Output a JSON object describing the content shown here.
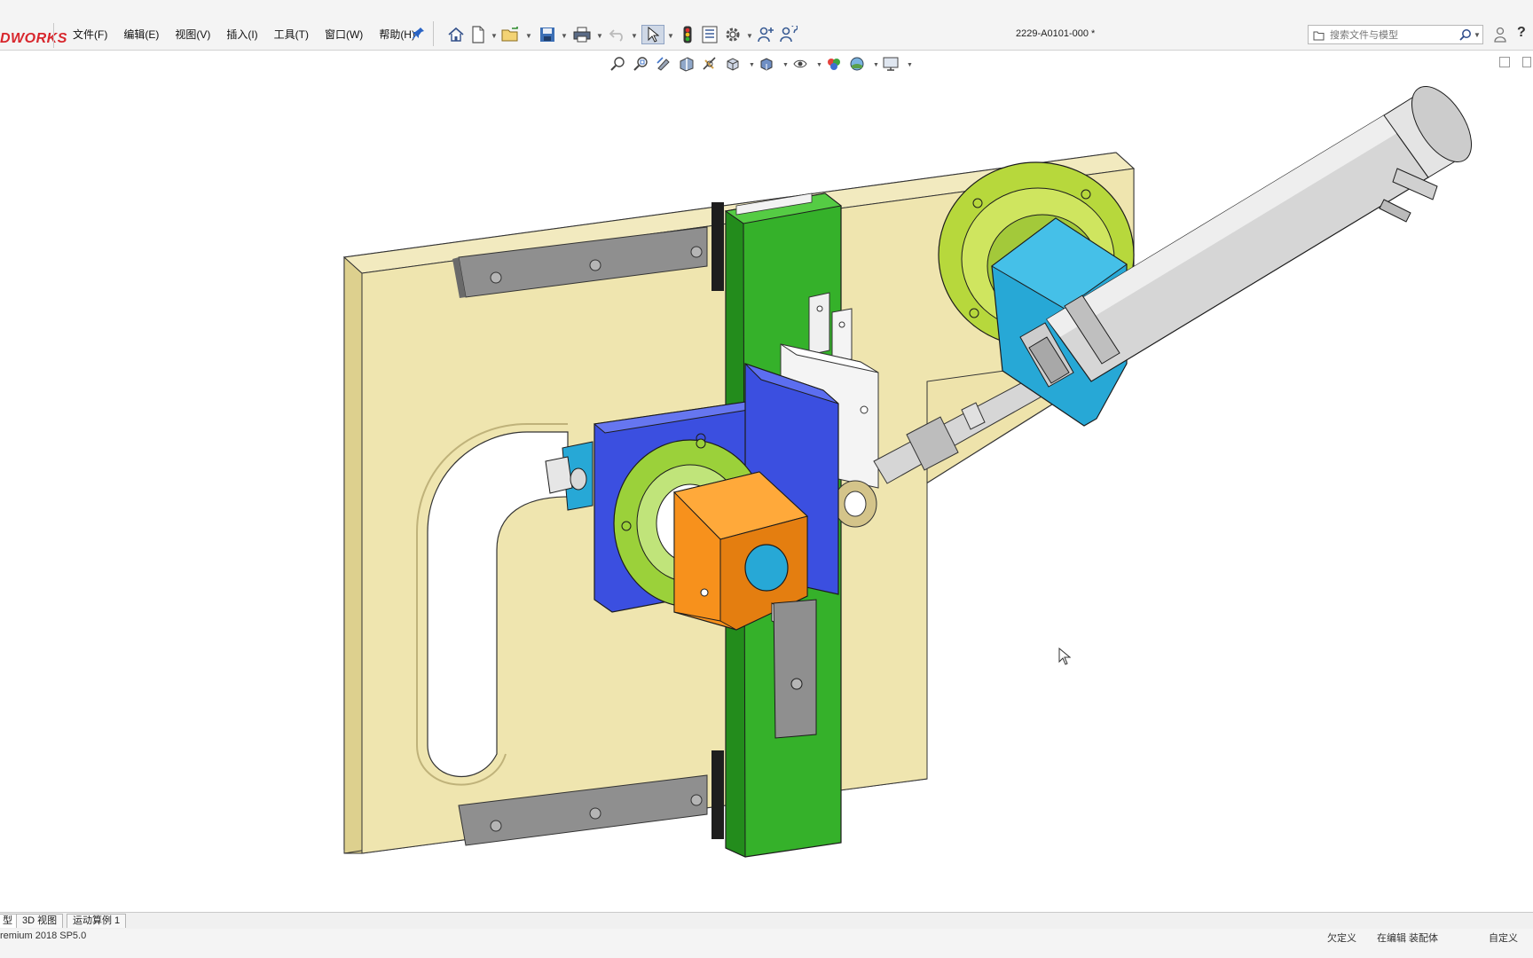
{
  "app": {
    "logo_text": "DWORKS",
    "document_title": "2229-A0101-000 *"
  },
  "menu": {
    "items": [
      "文件(F)",
      "编辑(E)",
      "视图(V)",
      "插入(I)",
      "工具(T)",
      "窗口(W)",
      "帮助(H)"
    ]
  },
  "search": {
    "placeholder": "搜索文件与模型"
  },
  "bottom_tabs": {
    "items": [
      "型",
      "3D 视图",
      "运动算例 1"
    ],
    "active_index": 0
  },
  "status": {
    "left_text": "remium 2018 SP5.0",
    "right_1": "欠定义",
    "right_2": "在编辑 装配体",
    "right_3": "自定义"
  },
  "icons": {
    "toolbar": [
      "home-icon",
      "new-document-icon",
      "open-folder-icon",
      "save-icon",
      "print-icon",
      "undo-icon",
      "select-arrow-icon",
      "traffic-light-icon",
      "file-properties-icon",
      "options-gear-icon",
      "user-assist-icon",
      "user-help-icon"
    ],
    "heads_up": [
      "zoom-to-fit-icon",
      "zoom-area-icon",
      "previous-view-icon",
      "section-view-icon",
      "dynamic-annotation-icon",
      "view-orientation-icon",
      "display-style-icon",
      "hide-show-icon",
      "edit-appearance-icon",
      "scene-icon",
      "view-settings-icon"
    ]
  },
  "colors": {
    "plate": "#e9e0a8",
    "rail": "#8c8c8c",
    "slider_green": "#35b12a",
    "mount_blue": "#3b4fe0",
    "flange_green": "#9bd13a",
    "block_orange": "#f7911c",
    "cylinder_mount_cyan": "#27a8d6",
    "cylinder_gray": "#d4d4d4",
    "brand_red": "#d8272d"
  }
}
